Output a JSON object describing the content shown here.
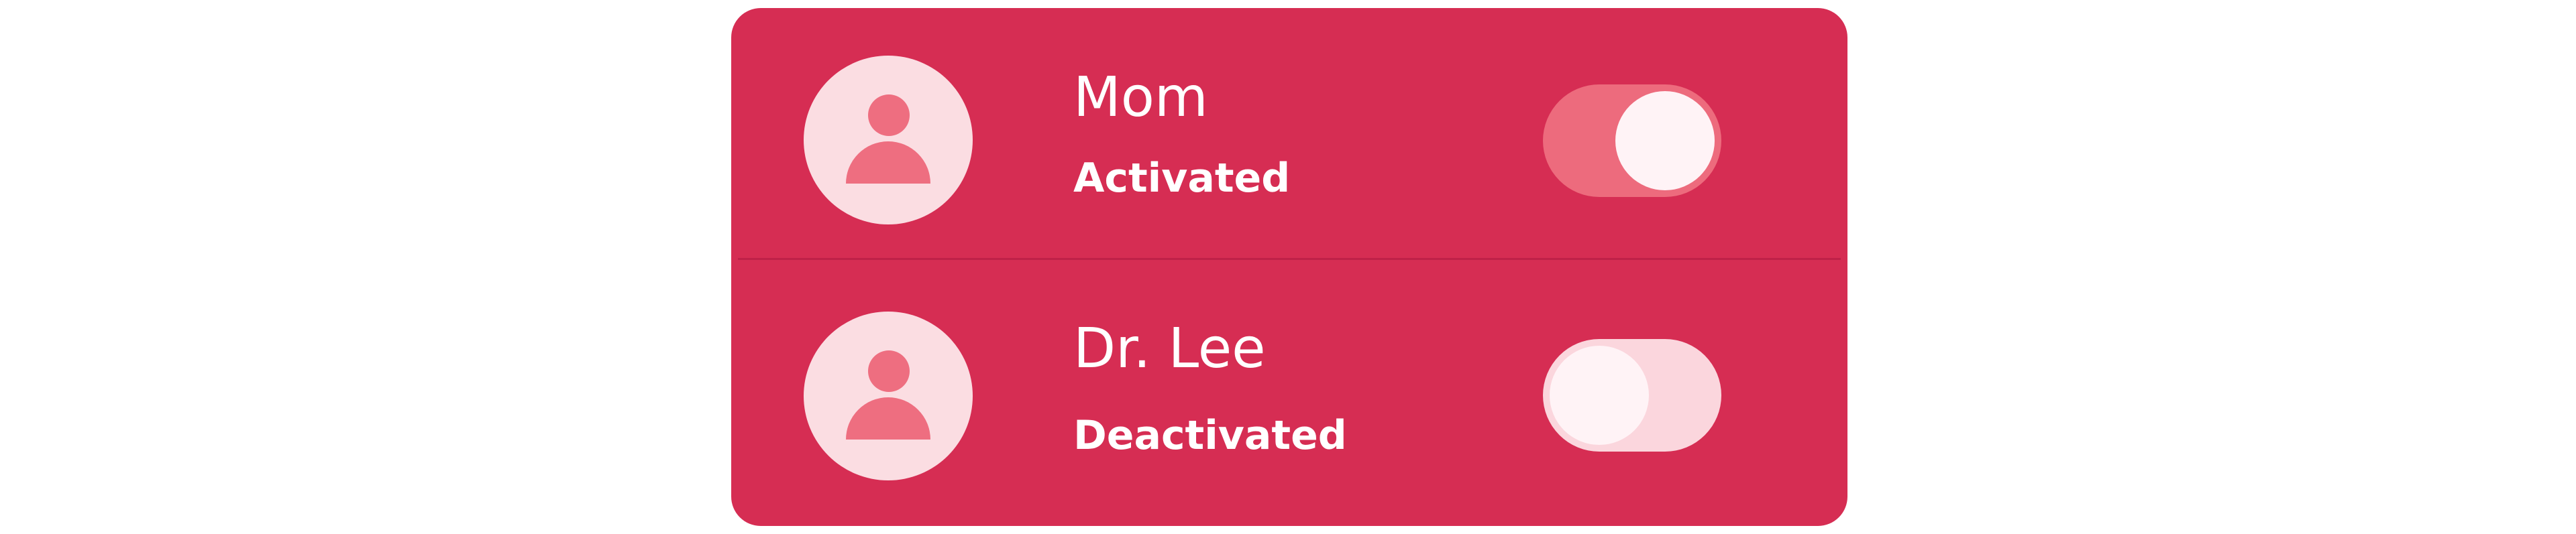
{
  "contacts": [
    {
      "name": "Mom",
      "status": "Activated",
      "enabled": true
    },
    {
      "name": "Dr. Lee",
      "status": "Deactivated",
      "enabled": false
    }
  ],
  "icons": {
    "avatar": "person-icon"
  },
  "colors": {
    "card": "#d62d53",
    "avatar_bg": "#fbdde2",
    "avatar_figure": "#ee6e80",
    "toggle_on_track": "#ed6b7d",
    "toggle_off_track": "#fbd6dd",
    "toggle_knob": "#fff3f6",
    "text": "#ffffff"
  }
}
